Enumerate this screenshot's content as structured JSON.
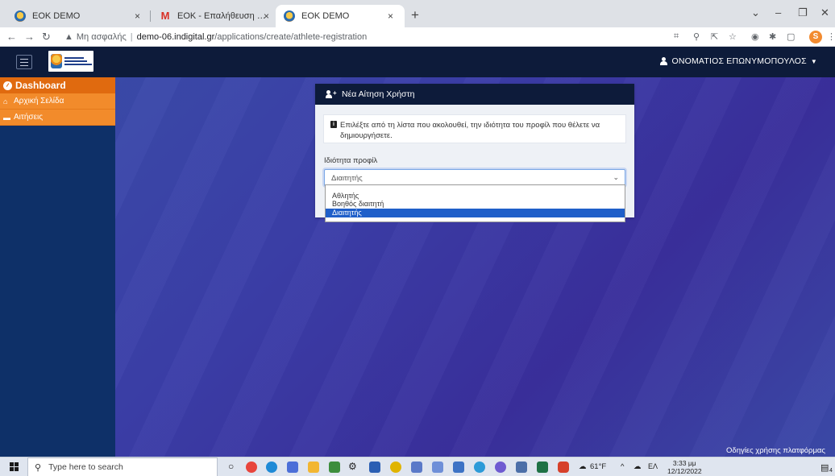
{
  "browser": {
    "tabs": [
      {
        "title": "EOK DEMO",
        "favicon": "eok-icon",
        "active": false
      },
      {
        "title": "EOK - Επαλήθευση email χρήστη",
        "favicon": "gmail-icon",
        "active": false
      },
      {
        "title": "EOK DEMO",
        "favicon": "eok-icon",
        "active": true
      }
    ],
    "new_tab": "+",
    "close_glyph": "×",
    "address": {
      "security_label": "Μη ασφαλής",
      "domain": "demo-06.indigital.gr",
      "path": "/applications/create/athlete-registration"
    },
    "profile_initial": "S"
  },
  "topnav": {
    "user_name": "ΟΝΟΜΑΤΙΟΣ ΕΠΩΝΥΜΟΠΟΥΛΟΣ"
  },
  "sidebar": {
    "header": "Dashboard",
    "items": [
      {
        "label": "Αρχική Σελίδα",
        "icon": "home-icon"
      },
      {
        "label": "Αιτήσεις",
        "icon": "folder-icon"
      }
    ]
  },
  "card": {
    "title": "Νέα Αίτηση Χρήστη",
    "info_text": "Επιλέξτε από τη λίστα που ακολουθεί, την ιδιότητα του προφίλ που θέλετε να δημιουργήσετε.",
    "field_label": "Ιδιότητα προφίλ",
    "selected_value": "Διαιτητής",
    "options": [
      "Αθλητής",
      "Βοηθός διαιτητή",
      "Διαιτητής"
    ],
    "selected_index": 2
  },
  "footer_link": "Οδηγίες χρήσης πλατφόρμας",
  "taskbar": {
    "search_placeholder": "Type here to search",
    "weather": "61°F",
    "language": "ΕΛ",
    "time": "3:33 μμ",
    "date": "12/12/2022",
    "notification_count": "4"
  },
  "colors": {
    "nav_dark": "#0d1b3a",
    "sidebar_bg": "#0e3068",
    "sidebar_header": "#e06a0f",
    "sidebar_item": "#f28b2b",
    "selected_option": "#1f5fc9"
  }
}
